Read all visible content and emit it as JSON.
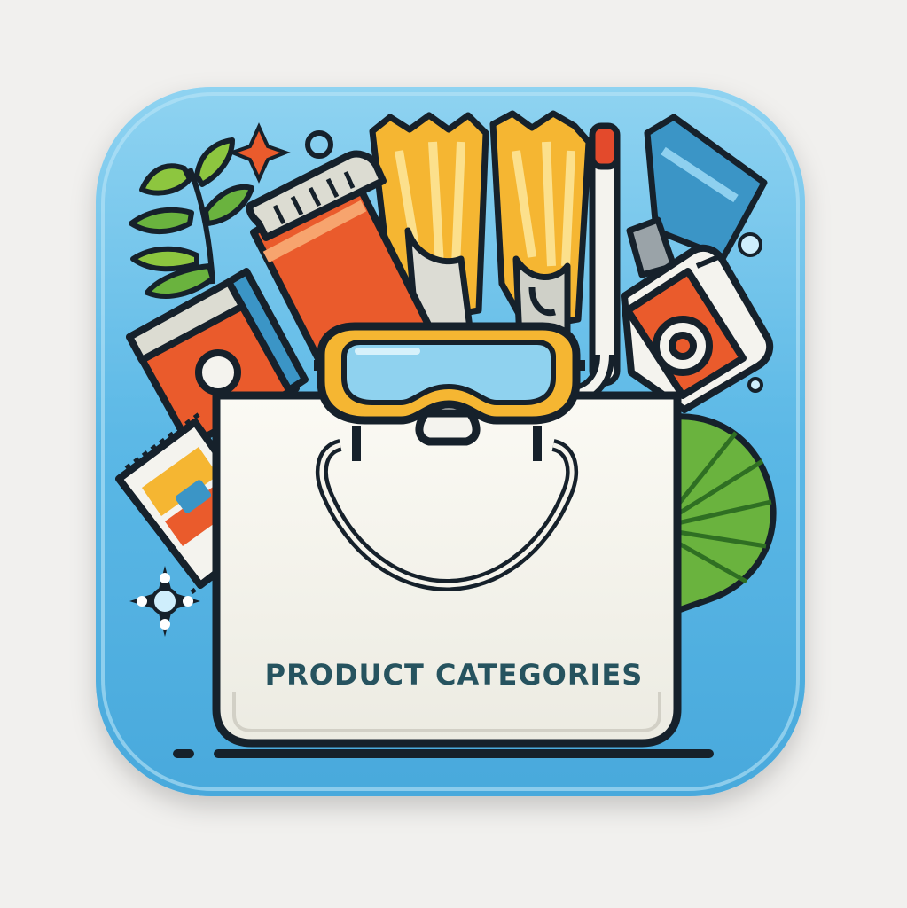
{
  "icon": {
    "caption": "PRODUCT CATEGORIES",
    "items": [
      "plant-leaves-icon",
      "sunscreen-tube-icon",
      "swim-fins-icon",
      "snorkel-icon",
      "dive-mask-icon",
      "smartphone-icon",
      "beach-towel-icon",
      "palm-leaf-icon",
      "sparkle-icon",
      "shopping-bag-icon"
    ]
  },
  "colors": {
    "background": "#f1f0ee",
    "tile": "#5bb8e6",
    "tile_light": "#9fd8f2",
    "outline": "#16212b",
    "bag": "#f6f4ec",
    "orange": "#ea5b2c",
    "yellow": "#f5b632",
    "green": "#6ab33e",
    "mask_lens": "#8fd2ef",
    "caption_text": "#26535f"
  }
}
